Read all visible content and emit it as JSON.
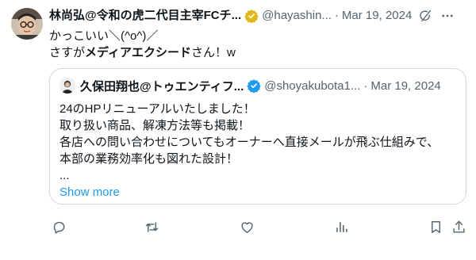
{
  "tweet": {
    "author_name": "林尚弘@令和の虎二代目主宰FCチ...",
    "handle": "@hayashin...",
    "dot": "·",
    "date": "Mar 19, 2024",
    "lines": {
      "line1": "かっこいい＼(^o^)／",
      "line2_pre": "さすが",
      "line2_bold": "メディアエクシード",
      "line2_post": "さん！w"
    }
  },
  "quote": {
    "author_name": "久保田翔也@トゥエンティフ...",
    "handle": "@shoyakubota1...",
    "dot": "·",
    "date": "Mar 19, 2024",
    "lines": [
      "24のHPリニューアルいたしました！",
      "取り扱い商品、解凍方法等も掲載！",
      "各店への問い合わせについてもオーナーへ直接メールが飛ぶ仕組みで、",
      "本部の業務効率化も図れた設計！",
      "..."
    ],
    "show_more": "Show more"
  },
  "icons": {
    "verified": "verified-badge-icon",
    "grok": "grok-icon",
    "more": "more-icon",
    "reply": "reply-icon",
    "retweet": "retweet-icon",
    "like": "like-icon",
    "views": "views-icon",
    "bookmark": "bookmark-icon",
    "share": "share-icon"
  },
  "colors": {
    "gold_badge": "#e2b719",
    "blue_badge": "#1d9bf0",
    "secondary": "#536471",
    "link": "#1d9bf0",
    "border": "#cfd9de"
  }
}
